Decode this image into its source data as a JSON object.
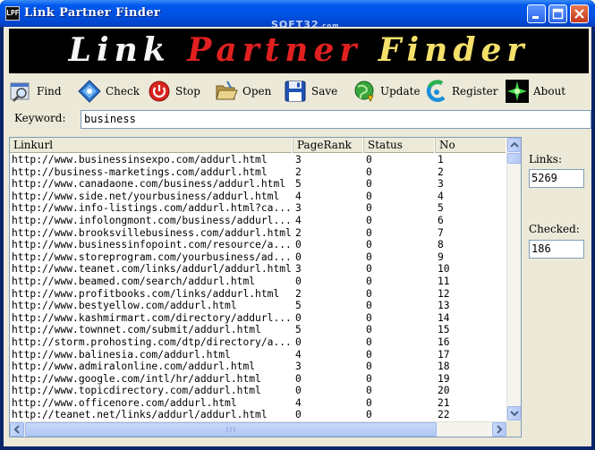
{
  "window": {
    "title": "Link Partner Finder",
    "app_icon_text": "LPF",
    "watermark_main": "SOFT32",
    "watermark_suffix": ".com"
  },
  "banner": {
    "word1": "Link",
    "word2": "Partner",
    "word3": "Finder"
  },
  "toolbar": {
    "find": "Find",
    "check": "Check",
    "stop": "Stop",
    "open": "Open",
    "save": "Save",
    "update": "Update",
    "register": "Register",
    "about": "About"
  },
  "keyword": {
    "label": "Keyword:",
    "value": "business"
  },
  "table": {
    "columns": [
      "Linkurl",
      "PageRank",
      "Status",
      "No"
    ],
    "rows": [
      [
        "http://www.businessinsexpo.com/addurl.html",
        "3",
        "0",
        "1"
      ],
      [
        "http://business-marketings.com/addurl.html",
        "2",
        "0",
        "2"
      ],
      [
        "http://www.canadaone.com/business/addurl.html",
        "5",
        "0",
        "3"
      ],
      [
        "http://www.side.net/yourbusiness/addurl.html",
        "4",
        "0",
        "4"
      ],
      [
        "http://www.info-listings.com/addurl.html?ca...",
        "3",
        "0",
        "5"
      ],
      [
        "http://www.infolongmont.com/business/addurl...",
        "4",
        "0",
        "6"
      ],
      [
        "http://www.brooksvillebusiness.com/addurl.html",
        "2",
        "0",
        "7"
      ],
      [
        "http://www.businessinfopoint.com/resource/a...",
        "0",
        "0",
        "8"
      ],
      [
        "http://www.storeprogram.com/yourbusiness/ad...",
        "0",
        "0",
        "9"
      ],
      [
        "http://www.teanet.com/links/addurl/addurl.html",
        "3",
        "0",
        "10"
      ],
      [
        "http://www.beamed.com/search/addurl.html",
        "0",
        "0",
        "11"
      ],
      [
        "http://www.profitbooks.com/links/addurl.html",
        "2",
        "0",
        "12"
      ],
      [
        "http://www.bestyellow.com/addurl.html",
        "5",
        "0",
        "13"
      ],
      [
        "http://www.kashmirmart.com/directory/addurl...",
        "0",
        "0",
        "14"
      ],
      [
        "http://www.townnet.com/submit/addurl.html",
        "5",
        "0",
        "15"
      ],
      [
        "http://storm.prohosting.com/dtp/directory/a...",
        "0",
        "0",
        "16"
      ],
      [
        "http://www.balinesia.com/addurl.html",
        "4",
        "0",
        "17"
      ],
      [
        "http://www.admiralonline.com/addurl.html",
        "3",
        "0",
        "18"
      ],
      [
        "http://www.google.com/intl/hr/addurl.html",
        "0",
        "0",
        "19"
      ],
      [
        "http://www.topicdirectory.com/addurl.html",
        "0",
        "0",
        "20"
      ],
      [
        "http://www.officenore.com/addurl.html",
        "4",
        "0",
        "21"
      ],
      [
        "http://teanet.net/links/addurl/addurl.html",
        "0",
        "0",
        "22"
      ]
    ]
  },
  "side": {
    "links_label": "Links:",
    "links_value": "5269",
    "checked_label": "Checked:",
    "checked_value": "186"
  },
  "colors": {
    "titlebar": "#0054e3",
    "client_bg": "#ece9d8",
    "banner_bg": "#000000",
    "banner_red": "#e02020",
    "banner_yellow": "#f5e06a"
  }
}
